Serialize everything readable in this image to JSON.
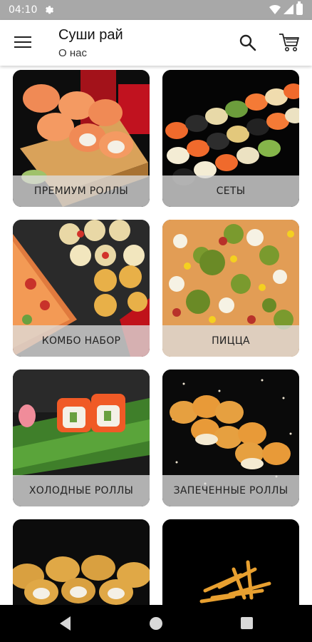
{
  "status_bar": {
    "time": "04:10"
  },
  "app_bar": {
    "title": "Суши рай",
    "subtitle": "О нас"
  },
  "categories": [
    {
      "label": "ПРЕМИУМ РОЛЛЫ"
    },
    {
      "label": "СЕТЫ"
    },
    {
      "label": "КОМБО НАБОР"
    },
    {
      "label": "ПИЦЦА"
    },
    {
      "label": "ХОЛОДНЫЕ РОЛЛЫ"
    },
    {
      "label": "ЗАПЕЧЕННЫЕ РОЛЛЫ"
    },
    {
      "label": ""
    },
    {
      "label": ""
    }
  ],
  "colors": {
    "status_bar": "#a8a8a8",
    "app_bar": "#ffffff",
    "nav_bar": "#000000",
    "tile_label_bg": "#dcdcdc"
  }
}
